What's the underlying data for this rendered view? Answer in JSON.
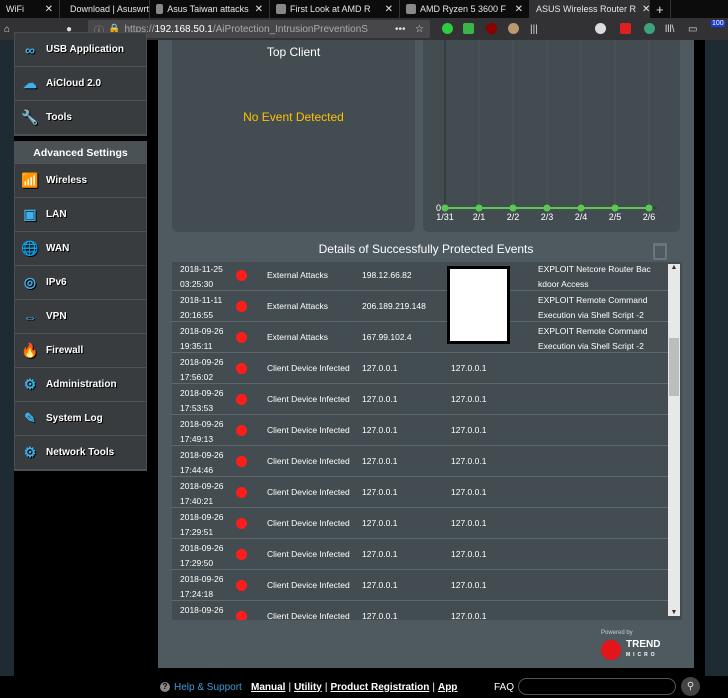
{
  "browser": {
    "tabs": [
      {
        "label": "WiFi",
        "active": false
      },
      {
        "label": "Download | Asuswrt",
        "active": false
      },
      {
        "label": "Asus Taiwan attacks",
        "active": false
      },
      {
        "label": "First Look at AMD R",
        "active": false
      },
      {
        "label": "AMD Ryzen 5 3600 F",
        "active": false
      },
      {
        "label": "ASUS Wireless Router R",
        "active": true
      }
    ],
    "new_tab": "+",
    "url_prefix": "https://",
    "url_host": "192.168.50.1",
    "url_path": "/AiProtection_IntrusionPreventionS",
    "badge": "100"
  },
  "sidebar": {
    "general": [
      {
        "label": "USB Application",
        "icon": "usb-icon"
      },
      {
        "label": "AiCloud 2.0",
        "icon": "cloud-icon"
      },
      {
        "label": "Tools",
        "icon": "wrench-icon"
      }
    ],
    "advanced_heading": "Advanced Settings",
    "advanced": [
      {
        "label": "Wireless",
        "icon": "wireless-icon"
      },
      {
        "label": "LAN",
        "icon": "lan-icon"
      },
      {
        "label": "WAN",
        "icon": "globe-icon"
      },
      {
        "label": "IPv6",
        "icon": "ipv6-icon"
      },
      {
        "label": "VPN",
        "icon": "vpn-icon"
      },
      {
        "label": "Firewall",
        "icon": "firewall-icon"
      },
      {
        "label": "Administration",
        "icon": "gear-icon"
      },
      {
        "label": "System Log",
        "icon": "log-icon"
      },
      {
        "label": "Network Tools",
        "icon": "network-tools-icon"
      }
    ]
  },
  "top_client": {
    "title": "Top Client",
    "empty": "No Event Detected"
  },
  "chart_data": {
    "type": "line",
    "categories": [
      "1/31",
      "2/1",
      "2/2",
      "2/3",
      "2/4",
      "2/5",
      "2/6"
    ],
    "values": [
      0,
      0,
      0,
      0,
      0,
      0,
      0
    ],
    "y_tick_labels": [
      "0"
    ],
    "color": "#5ac94f",
    "grid": true
  },
  "details": {
    "title": "Details of Successfully Protected Events",
    "rows": [
      {
        "date": "2018-11-25",
        "time": "03:25:30",
        "type": "External Attacks",
        "source": "198.12.66.82",
        "target": "",
        "desc1": "EXPLOIT Netcore Router Bac",
        "desc2": "kdoor Access"
      },
      {
        "date": "2018-11-11",
        "time": "20:16:55",
        "type": "External Attacks",
        "source": "206.189.219.148",
        "target": "",
        "desc1": "EXPLOIT Remote Command",
        "desc2": "Execution via Shell Script -2"
      },
      {
        "date": "2018-09-26",
        "time": "19:35:11",
        "type": "External Attacks",
        "source": "167.99.102.4",
        "target": "",
        "desc1": "EXPLOIT Remote Command",
        "desc2": "Execution via Shell Script -2"
      },
      {
        "date": "2018-09-26",
        "time": "17:56:02",
        "type": "Client Device Infected",
        "source": "127.0.0.1",
        "target": "127.0.0.1",
        "desc1": "",
        "desc2": ""
      },
      {
        "date": "2018-09-26",
        "time": "17:53:53",
        "type": "Client Device Infected",
        "source": "127.0.0.1",
        "target": "127.0.0.1",
        "desc1": "",
        "desc2": ""
      },
      {
        "date": "2018-09-26",
        "time": "17:49:13",
        "type": "Client Device Infected",
        "source": "127.0.0.1",
        "target": "127.0.0.1",
        "desc1": "",
        "desc2": ""
      },
      {
        "date": "2018-09-26",
        "time": "17:44:46",
        "type": "Client Device Infected",
        "source": "127.0.0.1",
        "target": "127.0.0.1",
        "desc1": "",
        "desc2": ""
      },
      {
        "date": "2018-09-26",
        "time": "17:40:21",
        "type": "Client Device Infected",
        "source": "127.0.0.1",
        "target": "127.0.0.1",
        "desc1": "",
        "desc2": ""
      },
      {
        "date": "2018-09-26",
        "time": "17:29:51",
        "type": "Client Device Infected",
        "source": "127.0.0.1",
        "target": "127.0.0.1",
        "desc1": "",
        "desc2": ""
      },
      {
        "date": "2018-09-26",
        "time": "17:29:50",
        "type": "Client Device Infected",
        "source": "127.0.0.1",
        "target": "127.0.0.1",
        "desc1": "",
        "desc2": ""
      },
      {
        "date": "2018-09-26",
        "time": "17:24:18",
        "type": "Client Device Infected",
        "source": "127.0.0.1",
        "target": "127.0.0.1",
        "desc1": "",
        "desc2": ""
      },
      {
        "date": "2018-09-26",
        "time": "",
        "type": "Client Device Infected",
        "source": "127.0.0.1",
        "target": "127.0.0.1",
        "desc1": "",
        "desc2": ""
      }
    ],
    "status_color": "#ff1c1c"
  },
  "powered_by": "Powered by",
  "vendor_logo": "TREND MICRO",
  "footer": {
    "help": "Help & Support",
    "links": [
      "Manual",
      "Utility",
      "Product Registration",
      "App"
    ],
    "faq": "FAQ",
    "faq_placeholder": ""
  }
}
